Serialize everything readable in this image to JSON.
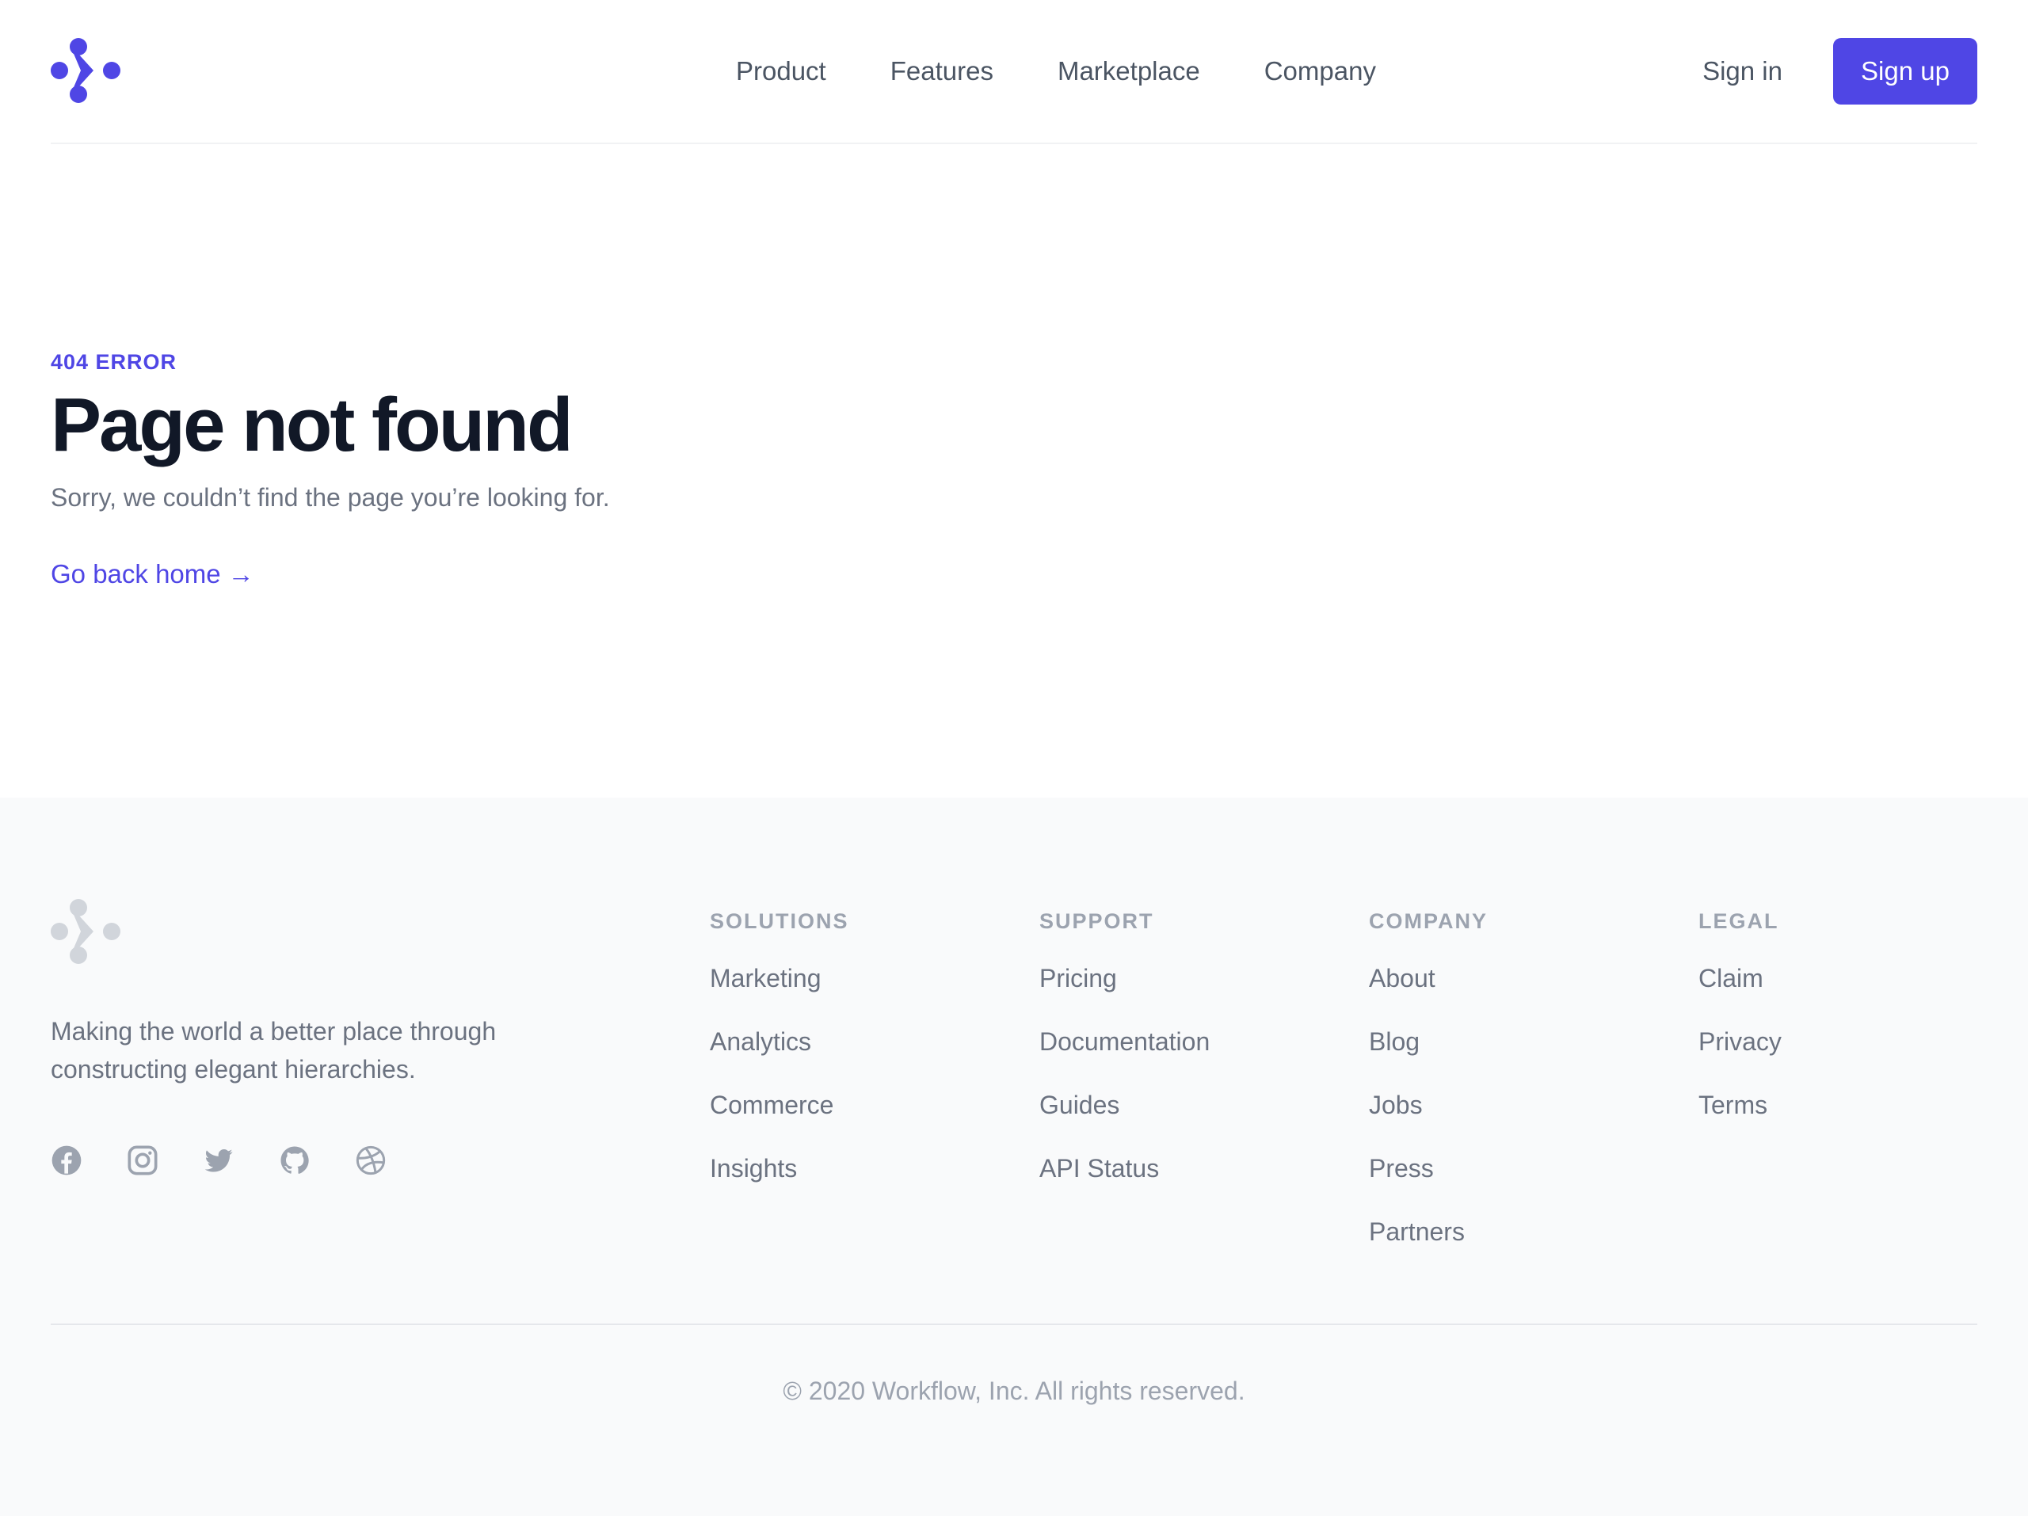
{
  "brand": {
    "accent": "#4f46e5",
    "logo_icon": "workflow-logo-icon"
  },
  "nav": {
    "items": [
      {
        "label": "Product"
      },
      {
        "label": "Features"
      },
      {
        "label": "Marketplace"
      },
      {
        "label": "Company"
      }
    ],
    "signin_label": "Sign in",
    "signup_label": "Sign up"
  },
  "error": {
    "label": "404 ERROR",
    "title": "Page not found",
    "subtitle": "Sorry, we couldn’t find the page you’re looking for.",
    "home_link": "Go back home →"
  },
  "footer": {
    "tagline": "Making the world a better place through constructing elegant hierarchies.",
    "socials": [
      "facebook-icon",
      "instagram-icon",
      "twitter-icon",
      "github-icon",
      "dribbble-icon"
    ],
    "columns": [
      {
        "title": "SOLUTIONS",
        "links": [
          "Marketing",
          "Analytics",
          "Commerce",
          "Insights"
        ]
      },
      {
        "title": "SUPPORT",
        "links": [
          "Pricing",
          "Documentation",
          "Guides",
          "API Status"
        ]
      },
      {
        "title": "COMPANY",
        "links": [
          "About",
          "Blog",
          "Jobs",
          "Press",
          "Partners"
        ]
      },
      {
        "title": "LEGAL",
        "links": [
          "Claim",
          "Privacy",
          "Terms"
        ]
      }
    ],
    "copyright": "© 2020 Workflow, Inc. All rights reserved."
  }
}
